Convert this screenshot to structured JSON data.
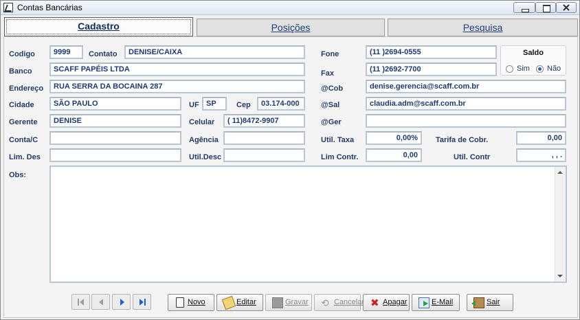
{
  "window": {
    "title": "Contas Bancárias"
  },
  "tabs": [
    {
      "label": "Cadastro"
    },
    {
      "label": "Posições"
    },
    {
      "label": "Pesquisa"
    }
  ],
  "labels": {
    "codigo": "Codigo",
    "contato": "Contato",
    "fone": "Fone",
    "banco": "Banco",
    "fax": "Fax",
    "endereco": "Endereço",
    "cob": "@Cob",
    "cidade": "Cidade",
    "uf": "UF",
    "cep": "Cep",
    "sal": "@Sal",
    "gerente": "Gerente",
    "celular": "Celular",
    "ger": "@Ger",
    "conta": "Conta/C",
    "agencia": "Agência",
    "util_taxa": "Util. Taxa",
    "tarifa_cobr": "Tarifa de Cobr.",
    "lim_des": "Lim. Des",
    "util_desc": "Util.Desc",
    "lim_contr": "Lim Contr.",
    "util_contr": "Util. Contr",
    "obs": "Obs:"
  },
  "fields": {
    "codigo": "9999",
    "contato": "DENISE/CAIXA",
    "fone": "(11 )2694-0555",
    "banco": "SCAFF PAPÉIS LTDA",
    "fax": "(11 )2692-7700",
    "endereco": "RUA SERRA DA BOCAINA 287",
    "cob": "denise.gerencia@scaff.com.br",
    "cidade": "SÃO PAULO",
    "uf": "SP",
    "cep": "03.174-000",
    "sal": "claudia.adm@scaff.com.br",
    "gerente": "DENISE",
    "celular": "( 11)8472-9907",
    "ger": "",
    "conta": "",
    "agencia": "",
    "util_taxa": "0,00%",
    "tarifa_cobr": "0,00",
    "lim_des": "",
    "util_desc": "",
    "lim_contr": "0,00",
    "util_contr": " ,  ,  .",
    "obs": ""
  },
  "saldo": {
    "title": "Saldo",
    "options": [
      {
        "label": "Sim",
        "selected": false
      },
      {
        "label": "Não",
        "selected": true
      }
    ]
  },
  "nav": {
    "first_icon": "first-record-icon",
    "prev_icon": "previous-record-icon",
    "next_icon": "next-record-icon",
    "last_icon": "last-record-icon"
  },
  "actions": [
    {
      "label": "Novo",
      "icon": "new-document-icon",
      "enabled": true
    },
    {
      "label": "Editar",
      "icon": "edit-pencil-icon",
      "enabled": true
    },
    {
      "label": "Gravar",
      "icon": "save-disk-icon",
      "enabled": false
    },
    {
      "label": "Cancelar",
      "icon": "undo-icon",
      "enabled": false
    },
    {
      "label": "Apagar",
      "icon": "delete-x-icon",
      "enabled": true
    },
    {
      "label": "E-Mail",
      "icon": "email-icon",
      "enabled": true
    },
    {
      "label": "Sair",
      "icon": "exit-door-icon",
      "enabled": true
    }
  ],
  "colors": {
    "label_text": "#223a66",
    "field_text": "#1c3a73",
    "field_border": "#b7c7d6",
    "nav_active": "#1b5fd3",
    "delete_red": "#d02121"
  }
}
